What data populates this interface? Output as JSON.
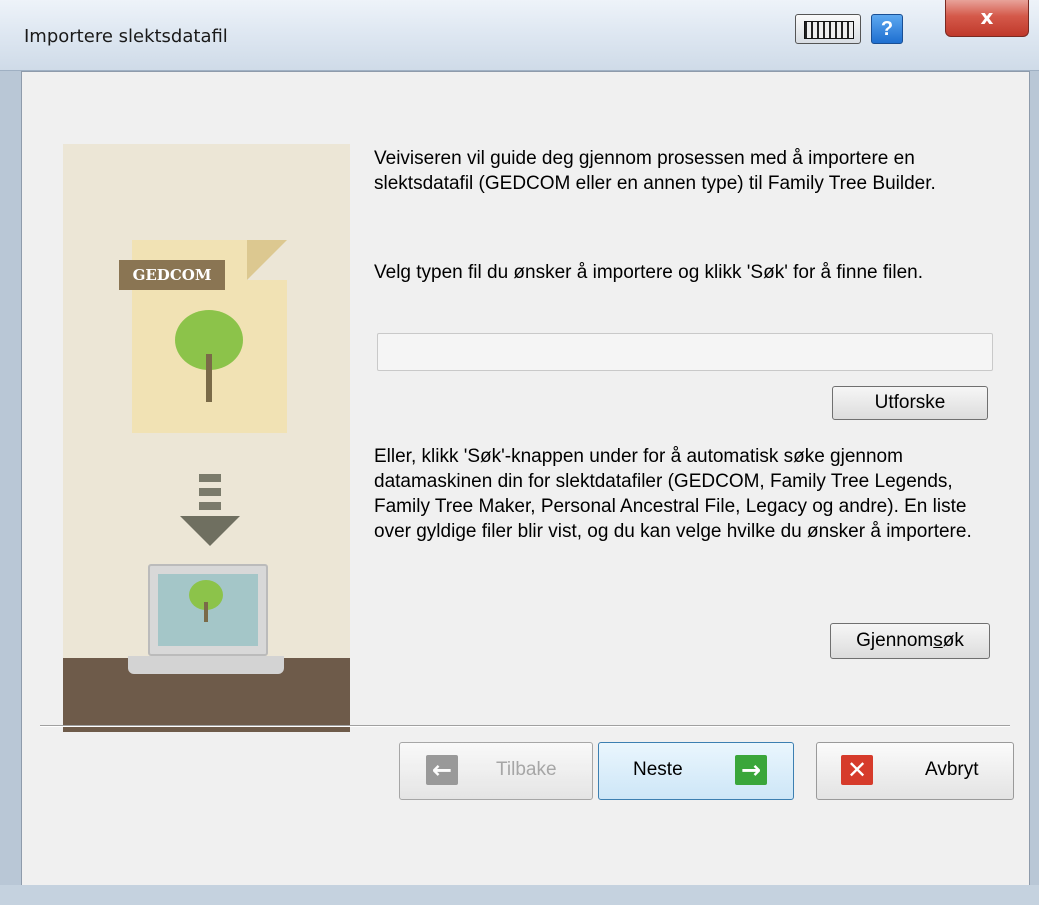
{
  "window": {
    "title": "Importere slektsdatafil",
    "help_label": "?",
    "close_label": "x"
  },
  "illustration": {
    "file_tag": "GEDCOM"
  },
  "main": {
    "intro": "Veiviseren vil guide deg gjennom prosessen med å importere en slektsdatafil (GEDCOM eller en annen type) til Family Tree Builder.",
    "choose_text": "Velg typen fil du ønsker å importere og klikk 'Søk' for å finne filen.",
    "file_path_value": "",
    "browse_label": "Utforske",
    "search_text": "Eller, klikk 'Søk'-knappen under for å automatisk søke gjennom datamaskinen din for slektdatafiler (GEDCOM, Family Tree Legends, Family Tree Maker, Personal Ancestral File, Legacy og andre). En liste over gyldige filer blir vist, og du kan velge hvilke du ønsker å importere.",
    "scan_label_prefix": "Gjennom",
    "scan_label_mnemonic": "s",
    "scan_label_suffix": "øk"
  },
  "footer": {
    "back_label": "Tilbake",
    "next_label": "Neste",
    "cancel_label": "Avbryt"
  },
  "colors": {
    "next_arrow": "#3aa63a",
    "cancel_x": "#d63b2b",
    "back_arrow": "#8a8a8a"
  }
}
